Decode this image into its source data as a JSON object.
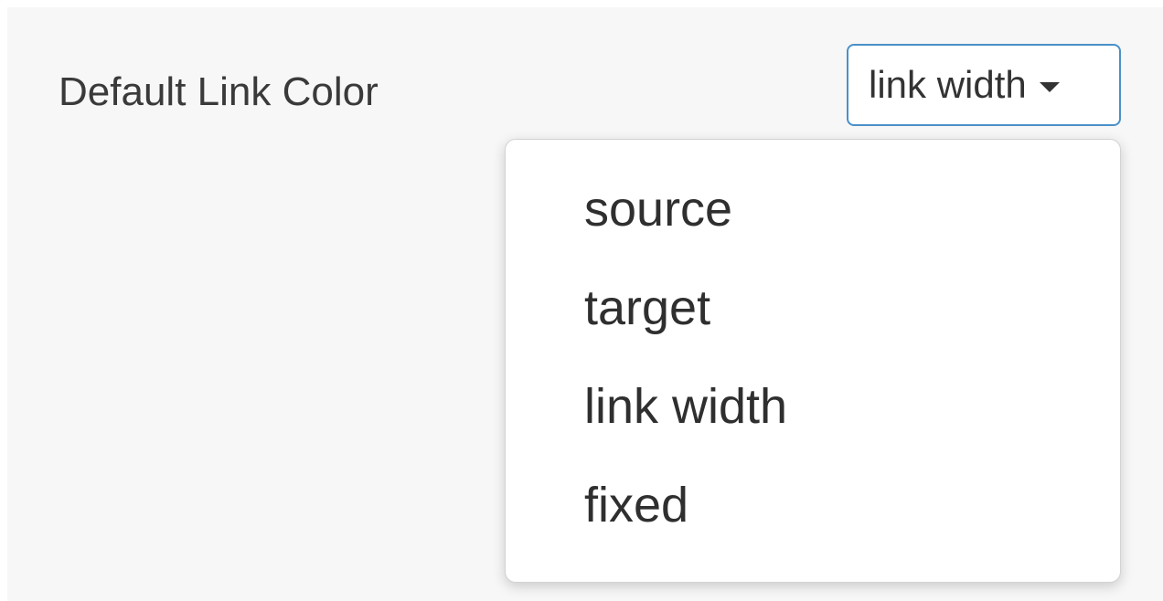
{
  "setting": {
    "label": "Default Link Color"
  },
  "select": {
    "value": "link width",
    "caret_icon": "caret-down-icon"
  },
  "menu": {
    "options": [
      "source",
      "target",
      "link width",
      "fixed"
    ]
  },
  "colors": {
    "accent_border": "#4a90c8",
    "panel_background": "#f7f7f7",
    "text": "#333333"
  }
}
